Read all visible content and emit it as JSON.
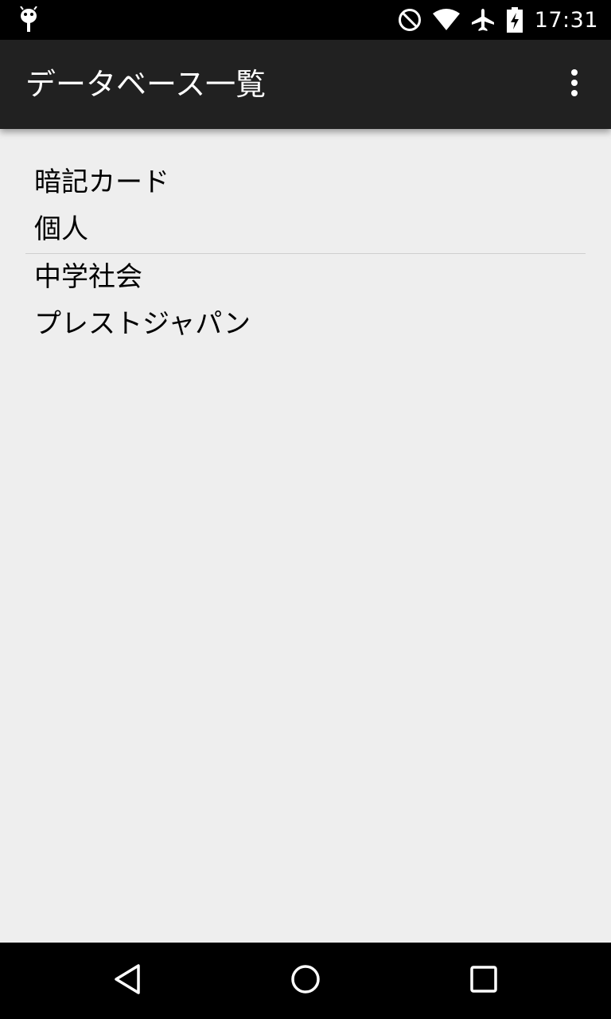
{
  "status_bar": {
    "time": "17:31",
    "icons": [
      "android-debug-icon",
      "do-not-disturb-icon",
      "wifi-icon",
      "airplane-mode-icon",
      "battery-charging-icon"
    ]
  },
  "action_bar": {
    "title": "データベース一覧",
    "overflow_icon": "more-vert-icon"
  },
  "list": {
    "items": [
      {
        "label": "暗記カード"
      },
      {
        "label": "個人"
      },
      {
        "label": "中学社会"
      },
      {
        "label": "プレストジャパン"
      }
    ]
  },
  "nav_bar": {
    "buttons": [
      "back-icon",
      "home-icon",
      "recents-icon"
    ]
  },
  "colors": {
    "status_bar_bg": "#000000",
    "action_bar_bg": "#212121",
    "content_bg": "#eeeeee",
    "divider": "#cfcfcf",
    "nav_bar_bg": "#000000"
  }
}
